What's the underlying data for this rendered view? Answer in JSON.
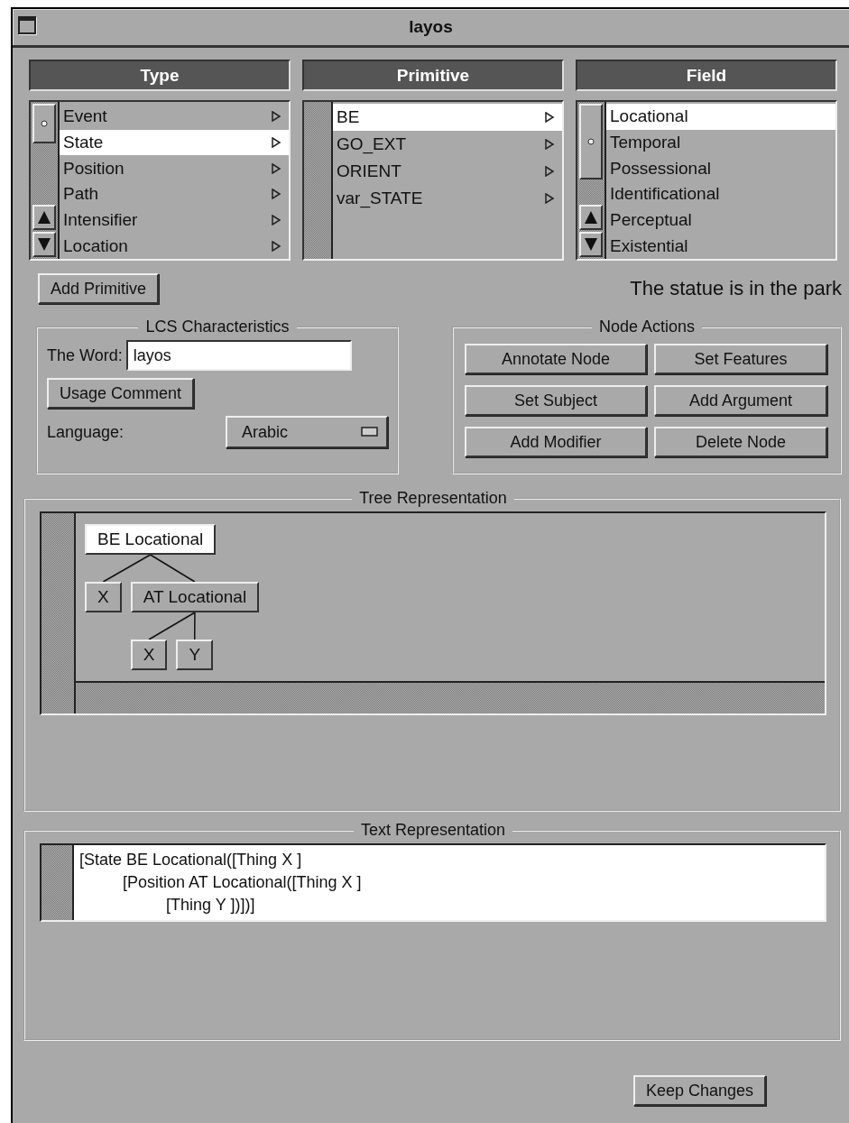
{
  "window": {
    "title": "layos"
  },
  "lists": [
    {
      "title": "Type",
      "kind": "cascading",
      "items": [
        {
          "label": "Event",
          "selected": false
        },
        {
          "label": "State",
          "selected": true
        },
        {
          "label": "Position",
          "selected": false
        },
        {
          "label": "Path",
          "selected": false
        },
        {
          "label": "Intensifier",
          "selected": false
        },
        {
          "label": "Location",
          "selected": false
        }
      ]
    },
    {
      "title": "Primitive",
      "kind": "cascading",
      "items": [
        {
          "label": "BE",
          "selected": true
        },
        {
          "label": "GO_EXT",
          "selected": false
        },
        {
          "label": "ORIENT",
          "selected": false
        },
        {
          "label": "var_STATE",
          "selected": false
        }
      ]
    },
    {
      "title": "Field",
      "kind": "plain",
      "items": [
        {
          "label": "Locational",
          "selected": true
        },
        {
          "label": "Temporal",
          "selected": false
        },
        {
          "label": "Possessional",
          "selected": false
        },
        {
          "label": "Identificational",
          "selected": false
        },
        {
          "label": "Perceptual",
          "selected": false
        },
        {
          "label": "Existential",
          "selected": false
        }
      ]
    }
  ],
  "add_primitive_button": "Add Primitive",
  "sentence": "The statue is in the park",
  "lcs": {
    "title": "LCS Characteristics",
    "word_label": "The Word:",
    "word_value": "layos",
    "usage_button": "Usage Comment",
    "language_label": "Language:",
    "language_value": "Arabic"
  },
  "node_actions": {
    "title": "Node Actions",
    "buttons": [
      "Annotate Node",
      "Set Features",
      "Set Subject",
      "Add Argument",
      "Add Modifier",
      "Delete Node"
    ]
  },
  "tree": {
    "title": "Tree Representation",
    "nodes": [
      {
        "label": "BE Locational",
        "selected": true,
        "children": [
          {
            "label": "X",
            "selected": false
          },
          {
            "label": "AT Locational",
            "selected": false,
            "children": [
              {
                "label": "X",
                "selected": false
              },
              {
                "label": "Y",
                "selected": false
              }
            ]
          }
        ]
      }
    ]
  },
  "text_representation": {
    "title": "Text Representation",
    "lines": [
      {
        "text": "[State BE Locational([Thing X ]",
        "children": [
          {
            "text": "[Position AT Locational([Thing X ]",
            "children": [
              {
                "text": "[Thing Y ])])]"
              }
            ]
          }
        ]
      }
    ]
  },
  "keep_changes_button": "Keep Changes"
}
